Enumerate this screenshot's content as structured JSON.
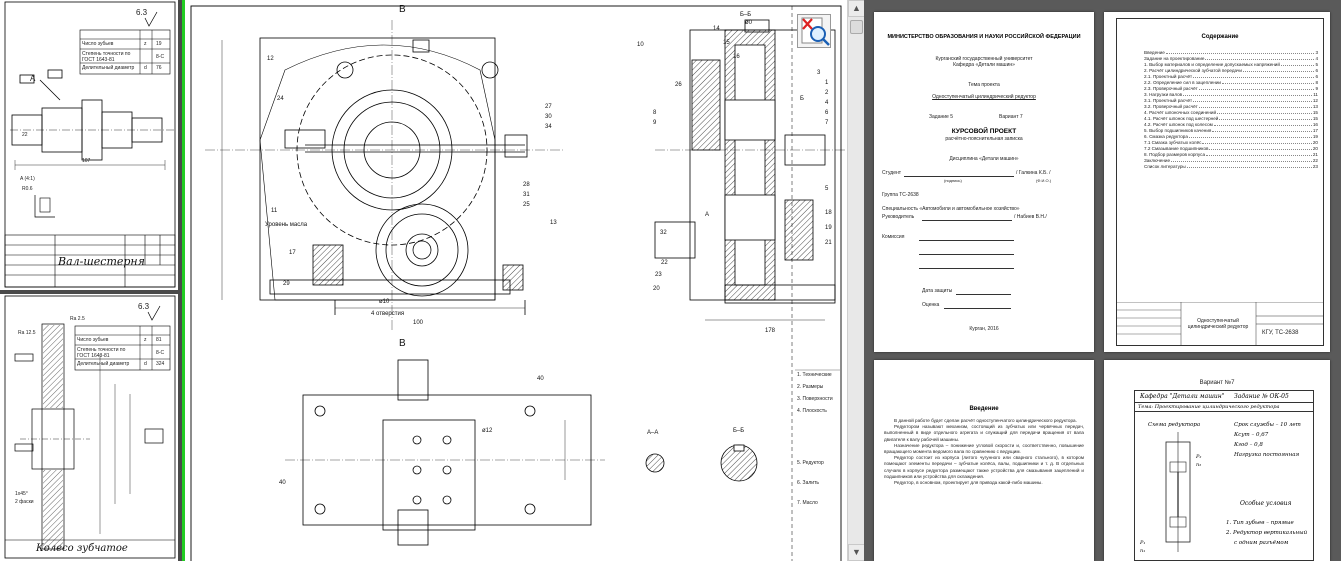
{
  "left_sheet_top": {
    "roughness": "6.3",
    "spec_rows": [
      {
        "label": "Число зубьев",
        "sym": "z",
        "val": "19"
      },
      {
        "label": "Степень точности по ГОСТ 1643-81",
        "sym": "",
        "val": "8-С"
      },
      {
        "label": "Делительный диаметр",
        "sym": "d",
        "val": "76"
      }
    ],
    "title": "Вал-шестерня",
    "dims": [
      "107",
      "R0.6",
      "22",
      "A",
      "A (4:1)"
    ]
  },
  "left_sheet_bottom": {
    "roughness": "6.3",
    "spec_rows": [
      {
        "label": "Число зубьев",
        "sym": "z",
        "val": "81"
      },
      {
        "label": "Степень точности по ГОСТ 1643-81",
        "sym": "",
        "val": "8-С"
      },
      {
        "label": "Делительный диаметр",
        "sym": "d",
        "val": "324"
      }
    ],
    "title": "Колесо зубчатое",
    "dims": [
      "Ra 12.5",
      "Ra 2.5",
      "1x45°",
      "2 фаски"
    ]
  },
  "main_drawing": {
    "labels": [
      "B",
      "12",
      "24",
      "11",
      "13",
      "Уровень масла",
      "17",
      "29",
      "27",
      "30",
      "34",
      "28",
      "31",
      "25",
      "100",
      "ø10",
      "4 отверстия",
      "В",
      "40",
      "ø12",
      "40",
      "А–А",
      "Б–Б",
      "10",
      "14",
      "15",
      "16",
      "26",
      "18",
      "32",
      "20",
      "23",
      "22",
      "21",
      "19",
      "9",
      "8",
      "1",
      "2",
      "3",
      "4",
      "6",
      "7",
      "5",
      "Б",
      "А",
      "178",
      "Б–Б",
      "ø0"
    ],
    "notes": [
      "1. Технические",
      "2. Размеры",
      "3. Поверхности",
      "4. Плоскость",
      "5. Редуктор",
      "6. Залить",
      "7. Масло"
    ]
  },
  "toolbar_icon": "zoom-magnifier-icon",
  "thumb_title": {
    "ministry": "МИНИСТЕРСТВО ОБРАЗОВАНИЯ И НАУКИ РОССИЙСКОЙ ФЕДЕРАЦИИ",
    "university": "Курганский государственный университет",
    "department": "Кафедра «Детали машин»",
    "topic_label": "Тема проекта",
    "topic": "Одноступенчатый цилиндрический редуктор",
    "task": "Задание 5",
    "variant": "Вариант 7",
    "kind": "КУРСОВОЙ ПРОЕКТ",
    "kind_sub": "расчётно-пояснительная записка",
    "discipline": "Дисциплина «Детали машин»",
    "student": "Студент",
    "student_name": "/ Галкина К.Б. /",
    "group": "Группа  ТС-2638",
    "speciality": "Специальность «Автомобили и автомобильное хозяйство»",
    "supervisor": "Руководитель",
    "supervisor_name": "/ Набиев В.Н./",
    "commission": "Комиссия",
    "defense": "Дата защиты",
    "grade": "Оценка",
    "city": "Курган, 2016",
    "sign_hint": "(подпись)",
    "date_hint": "(Ф.И.О.)"
  },
  "thumb_toc": {
    "title": "Содержание",
    "rows": [
      {
        "t": "Введение",
        "p": "3"
      },
      {
        "t": "Задание на проектирование",
        "p": "4"
      },
      {
        "t": "1. Выбор материалов и определение допускаемых напряжений",
        "p": "5"
      },
      {
        "t": "2. Расчёт цилиндрической зубчатой передачи",
        "p": "6"
      },
      {
        "t": "2.1. Проектный расчёт",
        "p": "6"
      },
      {
        "t": "2.2. Определение сил в зацеплении",
        "p": "8"
      },
      {
        "t": "2.3. Проверочный расчёт",
        "p": "9"
      },
      {
        "t": "3. Нагрузки валов",
        "p": "11"
      },
      {
        "t": "3.1. Проектный расчёт",
        "p": "12"
      },
      {
        "t": "3.2. Проверочный расчёт",
        "p": "13"
      },
      {
        "t": "4. Расчёт шпоночных соединений",
        "p": "15"
      },
      {
        "t": "4.1. Расчёт шпонок под шестерней",
        "p": "15"
      },
      {
        "t": "4.2. Расчёт шпонок под колесом",
        "p": "16"
      },
      {
        "t": "5. Выбор подшипников качения",
        "p": "17"
      },
      {
        "t": "6. Смазка редуктора",
        "p": "19"
      },
      {
        "t": "7.1 Смазка зубчатых колёс",
        "p": "20"
      },
      {
        "t": "7.2 Смазывание подшипников",
        "p": "20"
      },
      {
        "t": "8. Подбор размеров корпуса",
        "p": "21"
      },
      {
        "t": "Заключение",
        "p": "22"
      },
      {
        "t": "Список литературы",
        "p": "23"
      }
    ],
    "stamp_title": "Одноступенчатый цилиндрический редуктор",
    "stamp_code": "КГУ, ТС-2638"
  },
  "thumb_intro": {
    "title": "Введение",
    "paras": [
      "В данной работе будет сделан расчёт одноступенчатого цилиндрического редуктора.",
      "Редуктором называют механизм, состоящий из зубчатых или червячных передач, выполненный в виде отдельного агрегата и служащий для передачи вращения от вала двигателя к валу рабочей машины.",
      "Назначение редуктора – понижение угловой скорости и, соответственно, повышение вращающего момента ведомого вала по сравнению с ведущим.",
      "Редуктор состоит из корпуса (литого чугунного или сварного стального), в котором помещают элементы передачи – зубчатые колёса, валы, подшипники и т. д. В отдельных случаях в корпусе редуктора размещают также устройства для смазывания зацеплений и подшипников или устройства для охлаждения.",
      "Редуктор, в основном, проектирует для привода какой-либо машины."
    ]
  },
  "thumb_task": {
    "variant": "Вариант №7",
    "dept": "Кафедра \"Детали машин\"",
    "task_no": "Задание  № ОК-05",
    "theme": "Тема: Проектирование цилиндрического редуктора",
    "scheme": "Схема редуктора",
    "params": [
      "Срок службы – 10 лет",
      "Ксут – 0,67",
      "Кгод – 0,8",
      "Нагрузка постоянная"
    ],
    "special": "Особые условия",
    "conditions": [
      "1. Тип зубьев – прямые",
      "2. Редуктор вертикальный",
      "с одним разъёмом"
    ],
    "p1": "P₁",
    "n1": "n₁",
    "p2": "P₂",
    "n2": "n₂"
  }
}
